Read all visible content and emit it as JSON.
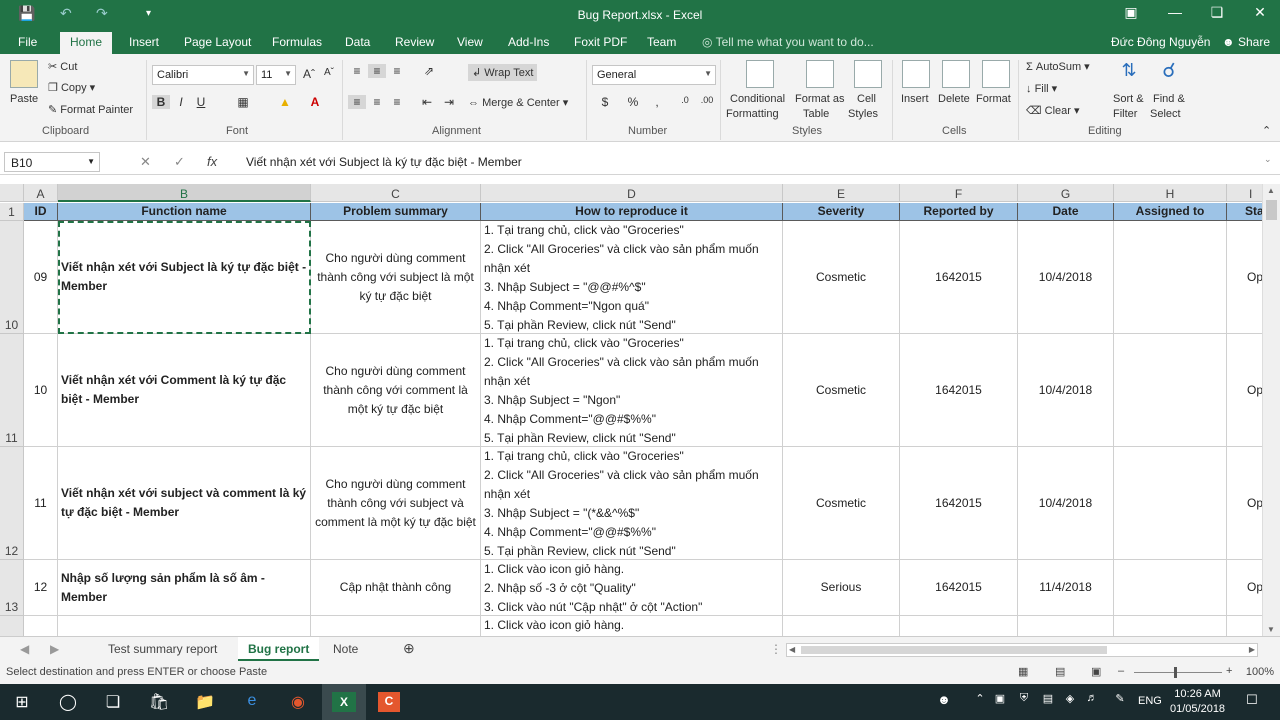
{
  "window": {
    "title": "Bug Report.xlsx - Excel",
    "user": "Đức Đông Nguyễn",
    "share": "Share"
  },
  "tabs": [
    "File",
    "Home",
    "Insert",
    "Page Layout",
    "Formulas",
    "Data",
    "Review",
    "View",
    "Add-Ins",
    "Foxit PDF",
    "Team"
  ],
  "tell_me": "Tell me what you want to do...",
  "ribbon": {
    "clipboard": {
      "paste": "Paste",
      "cut": "Cut",
      "copy": "Copy",
      "format_painter": "Format Painter",
      "label": "Clipboard"
    },
    "font": {
      "name": "Calibri",
      "size": "11",
      "label": "Font"
    },
    "alignment": {
      "wrap": "Wrap Text",
      "merge": "Merge & Center",
      "label": "Alignment"
    },
    "number": {
      "format": "General",
      "label": "Number"
    },
    "styles": {
      "cond": "Conditional",
      "cond2": "Formatting",
      "fmt_table": "Format as",
      "fmt_table2": "Table",
      "cell_styles": "Cell",
      "cell_styles2": "Styles",
      "label": "Styles"
    },
    "cells": {
      "insert": "Insert",
      "delete": "Delete",
      "format": "Format",
      "label": "Cells"
    },
    "editing": {
      "autosum": "AutoSum",
      "fill": "Fill",
      "clear": "Clear",
      "sort": "Sort &",
      "sort2": "Filter",
      "find": "Find &",
      "find2": "Select",
      "label": "Editing"
    }
  },
  "formula_bar": {
    "name_box": "B10",
    "formula": "Viết nhận xét với Subject là ký tự đặc biệt - Member"
  },
  "columns": [
    "A",
    "B",
    "C",
    "D",
    "E",
    "F",
    "G",
    "H"
  ],
  "partial_column": "I",
  "headers": {
    "id": "ID",
    "function": "Function name",
    "problem": "Problem summary",
    "how": "How to reproduce it",
    "severity": "Severity",
    "reported": "Reported by",
    "date": "Date",
    "assigned": "Assigned to",
    "status_cut": "Sta"
  },
  "row_numbers": [
    "1",
    "10",
    "11",
    "12",
    "13"
  ],
  "rows": [
    {
      "id": "09",
      "function": "Viết nhận xét với Subject là ký tự đặc biệt - Member",
      "problem": "Cho người dùng comment thành công với subject là một ký tự đặc biệt",
      "steps": [
        "1. Tại trang chủ, click vào \"Groceries\"",
        "2. Click \"All Groceries\" và click vào sản phẩm muốn nhận xét",
        "3. Nhập Subject = \"@@#%^$\"",
        "4. Nhập Comment=\"Ngon quá\"",
        "5. Tại phần Review, click nút \"Send\""
      ],
      "severity": "Cosmetic",
      "reported": "1642015",
      "date": "10/4/2018",
      "status": "Op"
    },
    {
      "id": "10",
      "function": "Viết nhận xét với Comment là ký tự đặc biệt - Member",
      "problem": "Cho người dùng comment thành công với comment là một ký tự đặc biệt",
      "steps": [
        "1. Tại trang chủ, click vào \"Groceries\"",
        "2. Click \"All Groceries\" và click vào sản phẩm muốn nhận xét",
        "3. Nhập Subject = \"Ngon\"",
        "4. Nhập Comment=\"@@#$%%\"",
        "5. Tại phần Review, click nút \"Send\""
      ],
      "severity": "Cosmetic",
      "reported": "1642015",
      "date": "10/4/2018",
      "status": "Op"
    },
    {
      "id": "11",
      "function": "Viết nhận xét với subject và comment là ký tự đặc biệt - Member",
      "problem": "Cho người dùng comment thành công với subject và comment là một ký tự đặc biệt",
      "steps": [
        "1. Tại trang chủ, click vào \"Groceries\"",
        "2. Click \"All Groceries\" và click vào sản phẩm muốn nhận xét",
        "3. Nhập Subject = \"(*&&^%$\"",
        "4. Nhập Comment=\"@@#$%%\"",
        "5. Tại phần Review, click nút \"Send\""
      ],
      "severity": "Cosmetic",
      "reported": "1642015",
      "date": "10/4/2018",
      "status": "Op"
    },
    {
      "id": "12",
      "function": "Nhập số lượng sản phẩm là số âm - Member",
      "problem": "Cập nhật thành công",
      "steps": [
        "1. Click vào icon giỏ hàng.",
        "2. Nhập số -3 ở cột \"Quality\"",
        "3. Click vào nút \"Cập nhật\" ở cột \"Action\""
      ],
      "severity": "Serious",
      "reported": "1642015",
      "date": "11/4/2018",
      "status": "Op"
    }
  ],
  "next_row_step": "1. Click vào icon giỏ hàng.",
  "sheet_tabs": [
    "Test summary report",
    "Bug report",
    "Note"
  ],
  "status_bar": {
    "message": "Select destination and press ENTER or choose Paste",
    "zoom": "100%"
  },
  "taskbar": {
    "time": "10:26 AM",
    "date": "01/05/2018",
    "lang": "ENG"
  },
  "colors": {
    "accent": "#217346",
    "header_fill": "#9dc3e6"
  }
}
